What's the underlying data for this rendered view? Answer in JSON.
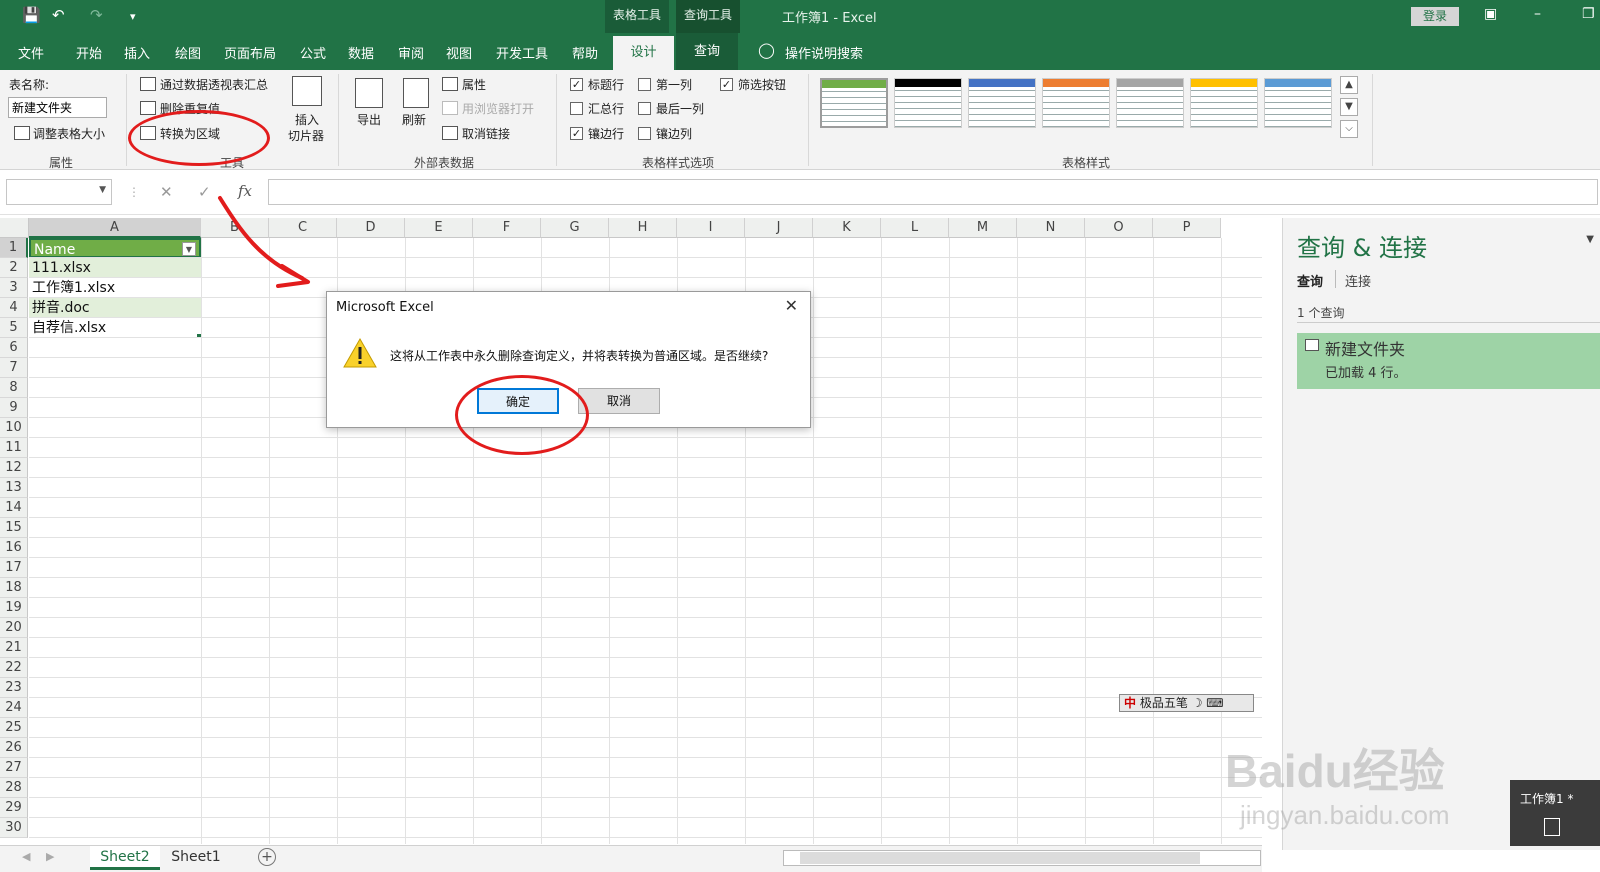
{
  "titlebar": {
    "context_tab_table": "表格工具",
    "context_tab_query": "查询工具",
    "window_title": "工作簿1 - Excel",
    "login": "登录"
  },
  "tabs": [
    "文件",
    "开始",
    "插入",
    "绘图",
    "页面布局",
    "公式",
    "数据",
    "审阅",
    "视图",
    "开发工具",
    "帮助"
  ],
  "active_tab": "设计",
  "query_tab": "查询",
  "tell_me": "操作说明搜索",
  "ribbon": {
    "props": {
      "table_name_label": "表名称:",
      "table_name_value": "新建文件夹",
      "resize": "调整表格大小",
      "group": "属性"
    },
    "tools": {
      "pivot": "通过数据透视表汇总",
      "remove_dup": "删除重复值",
      "convert": "转换为区域",
      "slicer_line1": "插入",
      "slicer_line2": "切片器",
      "group": "工具"
    },
    "external": {
      "export": "导出",
      "refresh": "刷新",
      "properties": "属性",
      "open_browser": "用浏览器打开",
      "unlink": "取消链接",
      "group": "外部表数据"
    },
    "style_options": {
      "header_row": "标题行",
      "total_row": "汇总行",
      "banded_rows": "镶边行",
      "first_col": "第一列",
      "last_col": "最后一列",
      "banded_cols": "镶边列",
      "filter_btn": "筛选按钮",
      "group": "表格样式选项"
    },
    "styles": {
      "group": "表格样式",
      "swatches": [
        "#70ad47",
        "#000000",
        "#4472c4",
        "#ed7d31",
        "#a5a5a5",
        "#ffc000",
        "#5b9bd5"
      ]
    }
  },
  "formula_bar": {
    "fx": "fx"
  },
  "grid": {
    "columns": [
      "A",
      "B",
      "C",
      "D",
      "E",
      "F",
      "G",
      "H",
      "I",
      "J",
      "K",
      "L",
      "M",
      "N",
      "O",
      "P"
    ],
    "rows": [
      "1",
      "2",
      "3",
      "4",
      "5",
      "6",
      "7",
      "8",
      "9",
      "10",
      "11",
      "12",
      "13",
      "14",
      "15",
      "16",
      "17",
      "18",
      "19",
      "20",
      "21",
      "22",
      "23",
      "24",
      "25",
      "26",
      "27",
      "28",
      "29",
      "30"
    ],
    "header_cell": "Name",
    "cells": [
      "111.xlsx",
      "工作簿1.xlsx",
      "拼音.doc",
      "自荐信.xlsx"
    ]
  },
  "dialog": {
    "title": "Microsoft Excel",
    "message": "这将从工作表中永久删除查询定义，并将表转换为普通区域。是否继续?",
    "ok": "确定",
    "cancel": "取消"
  },
  "pane": {
    "title": "查询 & 连接",
    "tab_queries": "查询",
    "tab_connections": "连接",
    "count": "1 个查询",
    "item_name": "新建文件夹",
    "item_status": "已加载 4 行。"
  },
  "sheets": [
    "Sheet2",
    "Sheet1"
  ],
  "ime": "极品五笔",
  "popup": "工作簿1 *",
  "watermark": "Baidu经验",
  "watermark_url": "jingyan.baidu.com",
  "colors": {
    "excel_green": "#217346",
    "annotation_red": "#e21c1c",
    "table_header": "#70ad47",
    "table_band": "#e2efda"
  }
}
